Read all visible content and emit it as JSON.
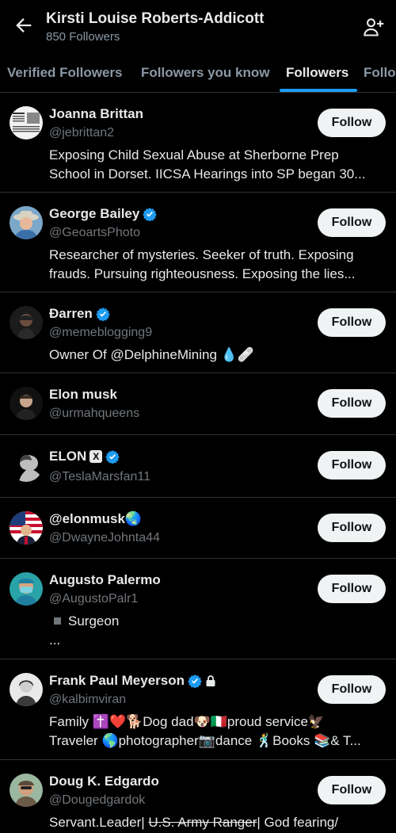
{
  "header": {
    "title": "Kirsti Louise Roberts-Addicott",
    "subtitle": "850 Followers"
  },
  "tabs": [
    {
      "label": "Verified Followers"
    },
    {
      "label": "Followers you know"
    },
    {
      "label": "Followers"
    },
    {
      "label": "Following"
    }
  ],
  "follow_label": "Follow",
  "users": [
    {
      "name": "Joanna Brittan",
      "handle": "@jebrittan2",
      "bio": [
        "Exposing Child Sexual Abuse at Sherborne Prep",
        "School in Dorset. IICSA Hearings into SP began 30..."
      ]
    },
    {
      "name": "George Bailey",
      "handle": "@GeoartsPhoto",
      "bio": [
        "Researcher of mysteries.  Seeker of truth.  Exposing",
        "frauds.  Pursuing righteousness.  Exposing the lies..."
      ]
    },
    {
      "name": "Ðarren",
      "handle": "@memeblogging9",
      "bio": [
        "Owner Of @DelphineMining 💧🩹"
      ]
    },
    {
      "name": "Elon musk",
      "handle": "@urmahqueens",
      "bio": []
    },
    {
      "name": "ELON",
      "name_tag": "X",
      "handle": "@TeslaMarsfan11",
      "bio": []
    },
    {
      "name": "@elonmusk🌏",
      "handle": "@DwayneJohnta44",
      "bio": []
    },
    {
      "name": "Augusto Palermo",
      "handle": "@AugustoPalr1",
      "bio": [
        "Surgeon",
        "..."
      ]
    },
    {
      "name": "Frank Paul Meyerson",
      "handle": "@kalbimviran",
      "bio": [
        "Family ✝️❤️🐕Dog dad🐶🇮🇹proud service🦅",
        "Traveler 🌎photographer📷dance 🕺Books 📚& T..."
      ]
    },
    {
      "name": "Doug K. Edgardo",
      "handle": "@Dougedgardok",
      "bio_a": "Servant.Leader| ",
      "bio_b": "U.S. Army Ranger",
      "bio_c": "| God fearing/"
    }
  ],
  "colors": {
    "accent": "#1d9bf0",
    "background": "#000000",
    "muted": "#71767b",
    "button_bg": "#eff3f4"
  }
}
